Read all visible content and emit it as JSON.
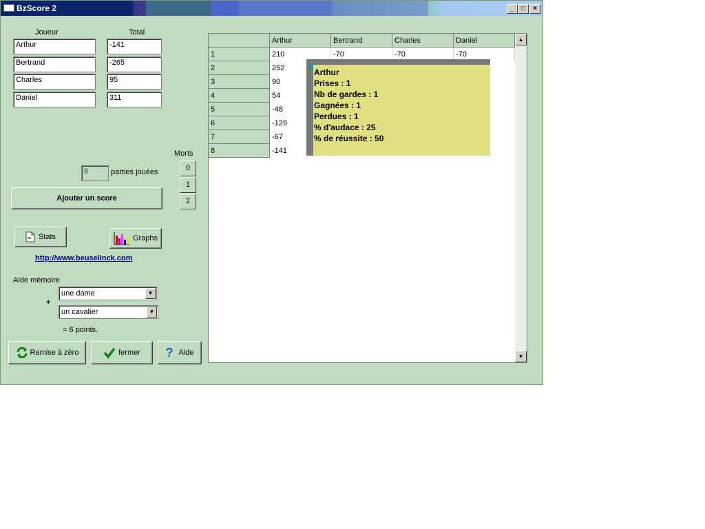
{
  "window": {
    "title": "BzScore 2",
    "minimize": "_",
    "maximize": "□",
    "close": "×"
  },
  "players": {
    "header_player": "Joueur",
    "header_total": "Total",
    "rows": [
      {
        "name": "Arthur",
        "total": "-141"
      },
      {
        "name": "Bertrand",
        "total": "-265"
      },
      {
        "name": "Charles",
        "total": "95"
      },
      {
        "name": "Daniel",
        "total": "311"
      }
    ]
  },
  "games": {
    "count": "8",
    "label": "parties jouées"
  },
  "morts": {
    "label": "Morts",
    "options": [
      "0",
      "1",
      "2"
    ]
  },
  "add_score_label": "Ajouter un score",
  "stats_label": "Stats",
  "graphs_label": "Graphs",
  "website": "http://www.beuselinck.com",
  "aide_memoire": {
    "label": "Aide mémoire",
    "plus": "+",
    "combo1": "une dame",
    "combo2": "un cavalier",
    "result": "= 6 points."
  },
  "bottom_buttons": {
    "reset": "Remise à zéro",
    "close": "fermer",
    "help": "Aide"
  },
  "score_table": {
    "columns": [
      "Arthur",
      "Bertrand",
      "Charles",
      "Daniel"
    ],
    "rows": [
      {
        "n": "1",
        "cells": [
          "210",
          "-70",
          "-70",
          "-70"
        ]
      },
      {
        "n": "2",
        "cells": [
          "252",
          "",
          "",
          ""
        ]
      },
      {
        "n": "3",
        "cells": [
          "90",
          "",
          "",
          ""
        ]
      },
      {
        "n": "4",
        "cells": [
          "54",
          "",
          "",
          ""
        ]
      },
      {
        "n": "5",
        "cells": [
          "-48",
          "",
          "",
          ""
        ]
      },
      {
        "n": "6",
        "cells": [
          "-129",
          "",
          "",
          ""
        ]
      },
      {
        "n": "7",
        "cells": [
          "-67",
          "",
          "",
          ""
        ]
      },
      {
        "n": "8",
        "cells": [
          "-141",
          "",
          "",
          ""
        ]
      }
    ]
  },
  "tooltip": {
    "lines": [
      "Arthur",
      "Prises : 1",
      "Nb de gardes : 1",
      "Gagnées : 1",
      "Perdues : 1",
      "% d'audace : 25",
      "% de réussite : 50"
    ]
  }
}
